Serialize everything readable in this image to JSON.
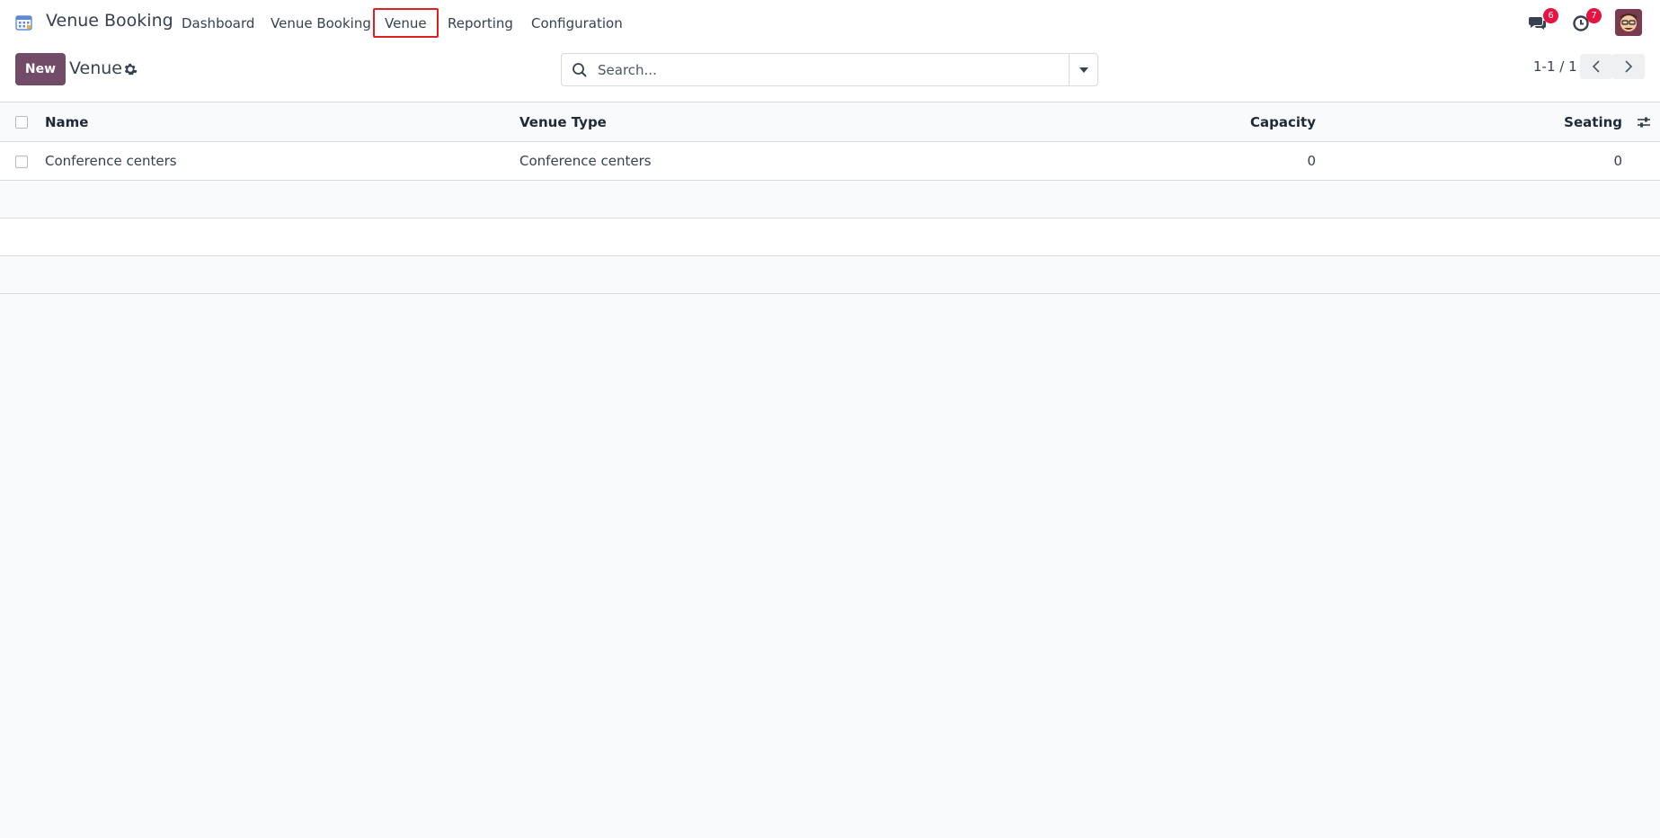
{
  "app": {
    "name": "Venue Booking"
  },
  "menu": [
    {
      "label": "Dashboard"
    },
    {
      "label": "Venue Booking"
    },
    {
      "label": "Venue",
      "active": true
    },
    {
      "label": "Reporting"
    },
    {
      "label": "Configuration"
    }
  ],
  "systray": {
    "messages_count": "6",
    "activities_count": "7"
  },
  "control_panel": {
    "new_label": "New",
    "title": "Venue",
    "search_placeholder": "Search...",
    "pager": "1-1 / 1"
  },
  "table": {
    "columns": [
      "Name",
      "Venue Type",
      "Capacity",
      "Seating"
    ],
    "rows": [
      {
        "name": "Conference centers",
        "venue_type": "Conference centers",
        "capacity": "0",
        "seating": "0"
      }
    ]
  },
  "colors": {
    "primary": "#714b67",
    "badge": "#e8133f",
    "active_outline": "#e02020"
  }
}
